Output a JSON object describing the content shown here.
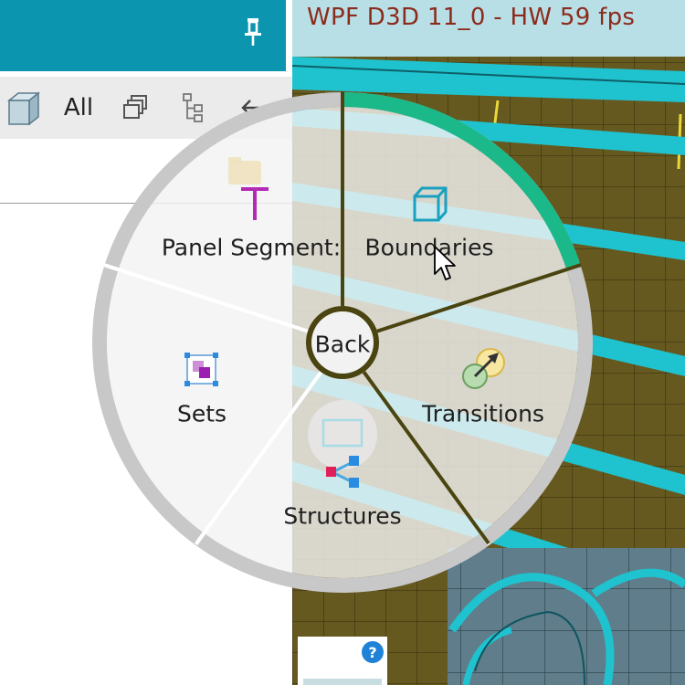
{
  "toolbar": {
    "all_label": "All"
  },
  "viewport": {
    "render_info": "WPF D3D 11_0 - HW  59 fps"
  },
  "radial_menu": {
    "center_label": "Back",
    "items": [
      {
        "label": "Panel Segment:",
        "icon": "text-t-icon"
      },
      {
        "label": "Boundaries",
        "icon": "cube-outline-icon"
      },
      {
        "label": "Transitions",
        "icon": "transition-arrow-icon"
      },
      {
        "label": "Structures",
        "icon": "structure-tree-icon"
      },
      {
        "label": "Sets",
        "icon": "sets-icon"
      }
    ],
    "active_item": "Boundaries"
  },
  "help": {
    "symbol": "?"
  },
  "colors": {
    "title_bar": "#0b95ae",
    "active_arc": "#1bb98a",
    "ring": "#c8c8c8",
    "viewport_olive": "#66591f",
    "viewport_cyan": "#1fc3cf",
    "fps_text": "#8b2b1c",
    "t_icon": "#b32ab6"
  }
}
